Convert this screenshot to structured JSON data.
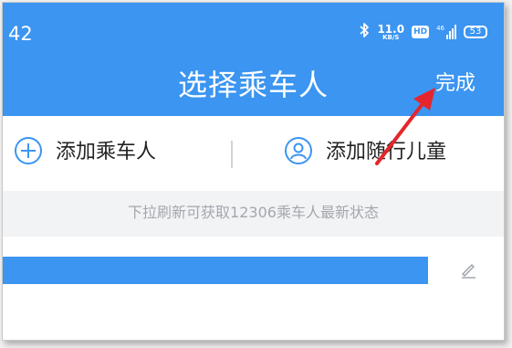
{
  "status_bar": {
    "time": "42",
    "net_speed_value": "11.0",
    "net_speed_unit": "KB/S",
    "hd_label": "HD",
    "signal_label": "46",
    "battery_level": "53",
    "icons": [
      "bluetooth-icon",
      "hd-icon",
      "signal-icon",
      "battery-icon"
    ]
  },
  "header": {
    "title": "选择乘车人",
    "done_label": "完成"
  },
  "actions": {
    "add_passenger_label": "添加乘车人",
    "add_child_label": "添加随行儿童"
  },
  "hint": {
    "text": "下拉刷新可获取12306乘车人最新状态"
  },
  "colors": {
    "accent": "#3b95f1",
    "annotation_arrow": "#e4262c",
    "hint_text": "#a3a7ad",
    "hint_background": "#f2f3f5"
  }
}
